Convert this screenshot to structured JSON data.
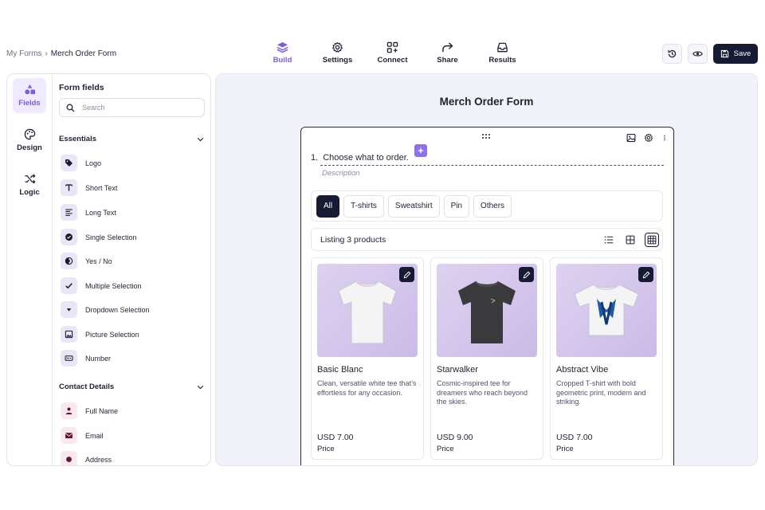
{
  "breadcrumb": {
    "parent": "My Forms",
    "separator": "›",
    "current": "Merch Order Form"
  },
  "topnav": [
    {
      "label": "Build",
      "icon": "layers-icon",
      "active": true
    },
    {
      "label": "Settings",
      "icon": "gear-icon"
    },
    {
      "label": "Connect",
      "icon": "connect-icon"
    },
    {
      "label": "Share",
      "icon": "share-icon"
    },
    {
      "label": "Results",
      "icon": "inbox-icon"
    }
  ],
  "actions": {
    "save_label": "Save"
  },
  "rail": [
    {
      "label": "Fields",
      "icon": "shapes-icon",
      "active": true
    },
    {
      "label": "Design",
      "icon": "palette-icon"
    },
    {
      "label": "Logic",
      "icon": "shuffle-icon"
    }
  ],
  "fields_panel": {
    "title": "Form fields",
    "search_placeholder": "Search",
    "sections": [
      {
        "title": "Essentials",
        "items": [
          "Logo",
          "Short Text",
          "Long Text",
          "Single Selection",
          "Yes / No",
          "Multiple Selection",
          "Dropdown Selection",
          "Picture Selection",
          "Number"
        ]
      },
      {
        "title": "Contact Details",
        "items": [
          "Full Name",
          "Email",
          "Address"
        ]
      }
    ]
  },
  "form": {
    "title": "Merch Order Form",
    "question_number": "1.",
    "question": "Choose what to order.",
    "description_placeholder": "Description",
    "filters": [
      "All",
      "T-shirts",
      "Sweatshirt",
      "Pin",
      "Others"
    ],
    "active_filter": "All",
    "listing_text": "Listing 3 products",
    "products": [
      {
        "name": "Basic Blanc",
        "description": "Clean, versatile white tee that’s effortless for any occasion.",
        "price": "USD 7.00",
        "price_label": "Price",
        "shirt_color": "#f4f4f4"
      },
      {
        "name": "Starwalker",
        "description": "Cosmic-inspired tee for dreamers who reach beyond the skies.",
        "price": "USD 9.00",
        "price_label": "Price",
        "shirt_color": "#3a3a3c"
      },
      {
        "name": "Abstract Vibe",
        "description": "Cropped T-shirt with bold geometric print, modern and striking.",
        "price": "USD 7.00",
        "price_label": "Price",
        "shirt_color": "#f4f4f4"
      }
    ]
  },
  "colors": {
    "accent": "#7c5ce0",
    "dark": "#171a33",
    "canvas_bg": "#f2f2fa",
    "print_blue": "#1f5aa8"
  }
}
